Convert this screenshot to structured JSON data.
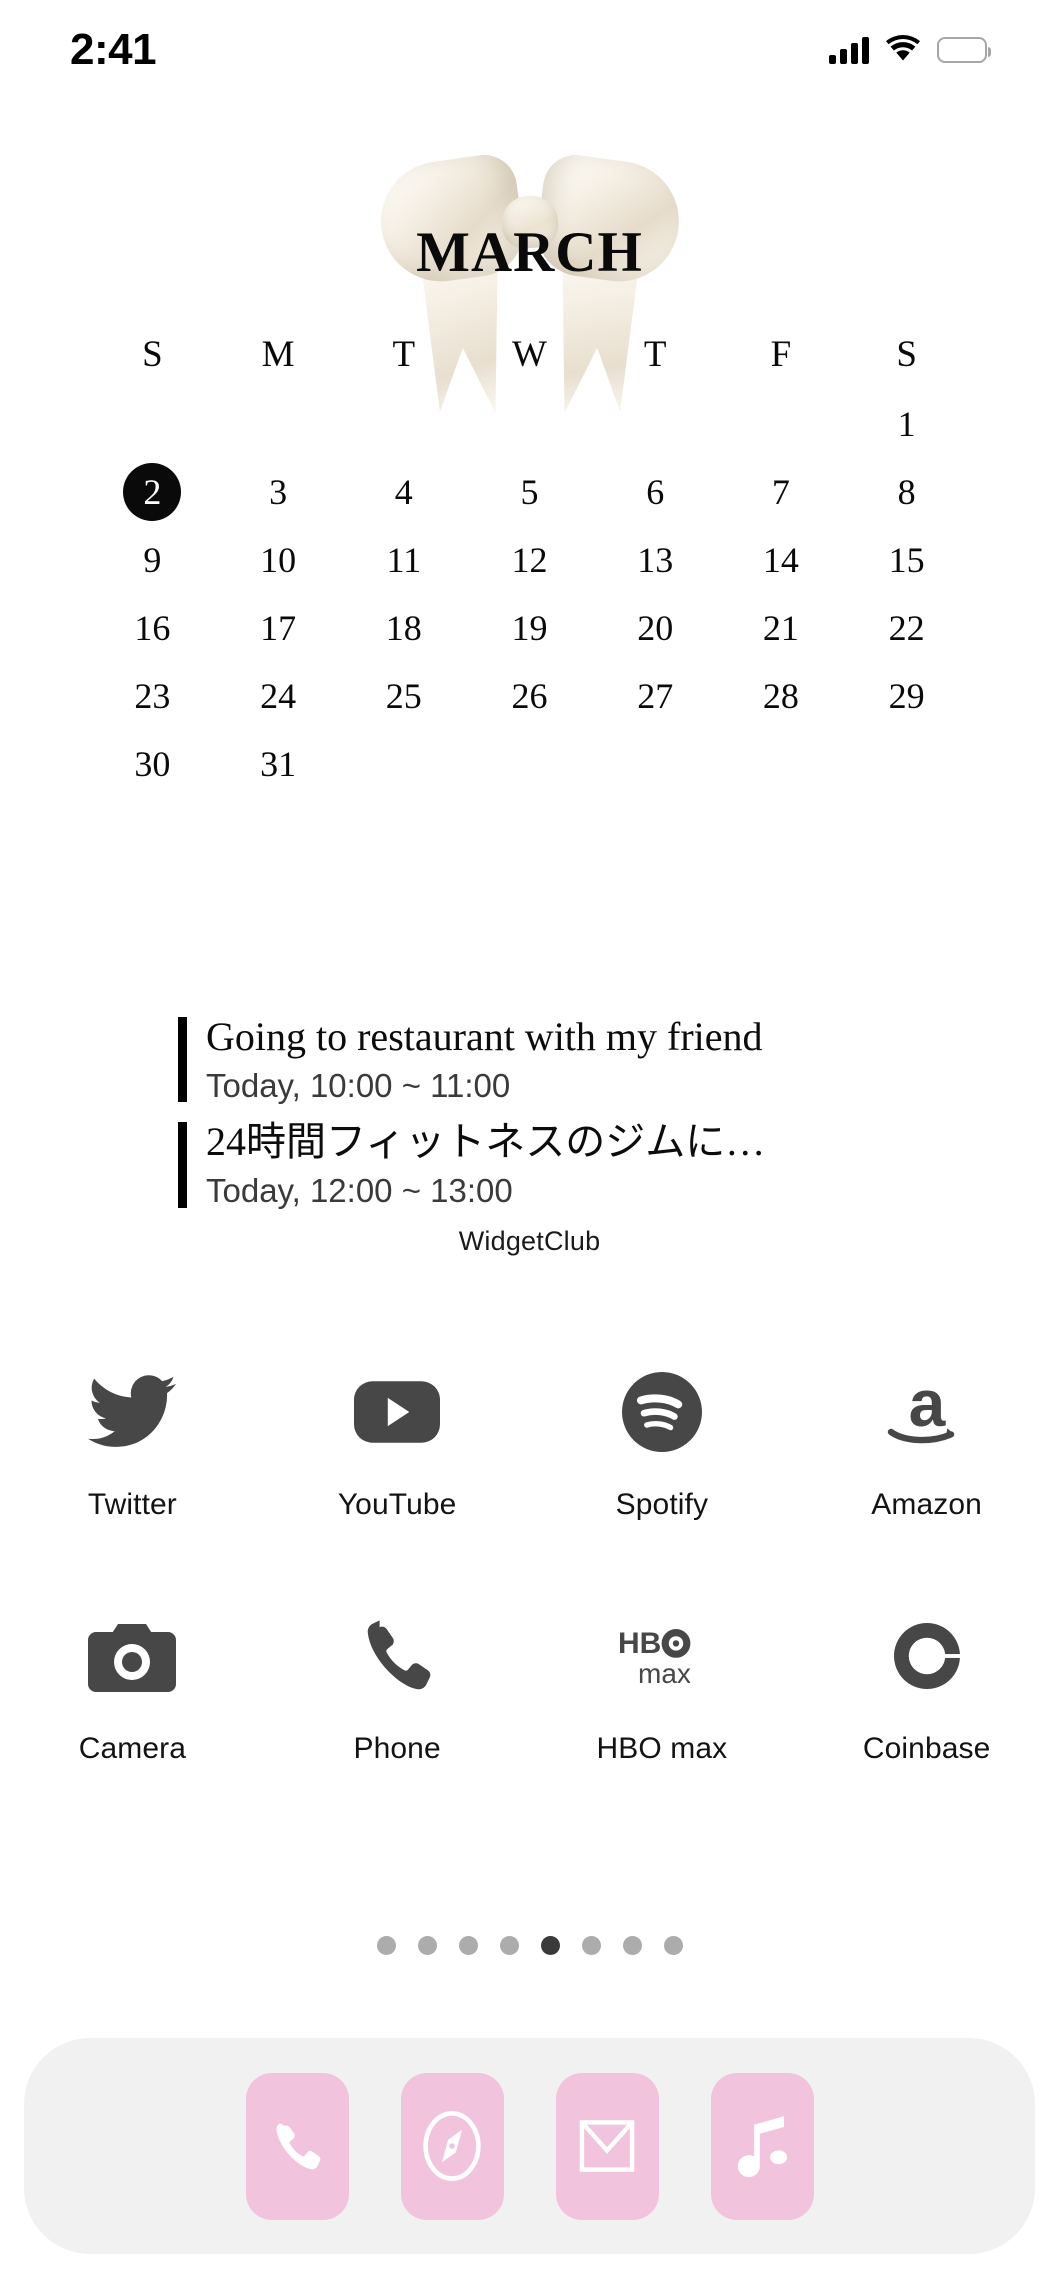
{
  "status_bar": {
    "time": "2:41",
    "signal_icon": "cellular-signal-icon",
    "wifi_icon": "wifi-icon",
    "battery_icon": "battery-full-icon"
  },
  "calendar_widget": {
    "month": "MARCH",
    "decoration": "satin-bow-image",
    "weekday_headers": [
      "S",
      "M",
      "T",
      "W",
      "T",
      "F",
      "S"
    ],
    "weeks": [
      [
        "",
        "",
        "",
        "",
        "",
        "",
        "1"
      ],
      [
        "2",
        "3",
        "4",
        "5",
        "6",
        "7",
        "8"
      ],
      [
        "9",
        "10",
        "11",
        "12",
        "13",
        "14",
        "15"
      ],
      [
        "16",
        "17",
        "18",
        "19",
        "20",
        "21",
        "22"
      ],
      [
        "23",
        "24",
        "25",
        "26",
        "27",
        "28",
        "29"
      ],
      [
        "30",
        "31",
        "",
        "",
        "",
        "",
        ""
      ]
    ],
    "today": "2",
    "events": [
      {
        "title": "Going to restaurant with my friend",
        "time": "Today, 10:00 ~ 11:00"
      },
      {
        "title": "24時間フィットネスのジムに…",
        "time": "Today, 12:00 ~ 13:00"
      }
    ],
    "label": "WidgetClub"
  },
  "apps": {
    "row1": [
      {
        "label": "Twitter",
        "icon": "twitter-bird-icon"
      },
      {
        "label": "YouTube",
        "icon": "youtube-play-icon"
      },
      {
        "label": "Spotify",
        "icon": "spotify-icon"
      },
      {
        "label": "Amazon",
        "icon": "amazon-icon"
      }
    ],
    "row2": [
      {
        "label": "Camera",
        "icon": "camera-icon"
      },
      {
        "label": "Phone",
        "icon": "phone-handset-icon"
      },
      {
        "label": "HBO max",
        "icon": "hbo-max-icon"
      },
      {
        "label": "Coinbase",
        "icon": "coinbase-icon"
      }
    ]
  },
  "page_dots": {
    "count": 8,
    "active_index": 4
  },
  "dock": {
    "apps": [
      {
        "name": "Phone",
        "icon": "phone-handset-icon"
      },
      {
        "name": "Safari",
        "icon": "compass-icon"
      },
      {
        "name": "Mail",
        "icon": "envelope-icon"
      },
      {
        "name": "Music",
        "icon": "music-note-icon"
      }
    ]
  },
  "colors": {
    "background": "#ffffff",
    "text": "#0a0a0a",
    "icon_gray": "#474747",
    "dock_background": "#f1f1f1",
    "dock_tile_pink": "#f2c3dd",
    "dot_inactive": "#acacac",
    "dot_active": "#3a3a3a"
  }
}
